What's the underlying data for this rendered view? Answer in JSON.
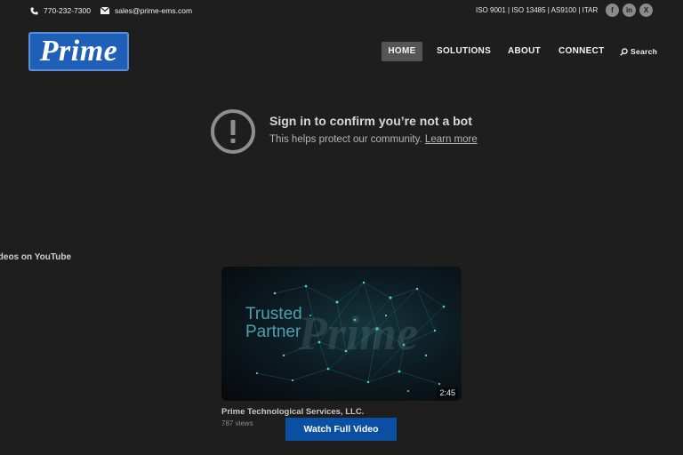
{
  "topbar": {
    "phone": "770-232-7300",
    "email": "sales@prime-ems.com",
    "certifications": "ISO 9001 | ISO 13485 | AS9100 | ITAR",
    "social": {
      "facebook": "f",
      "linkedin": "in",
      "x": "X"
    }
  },
  "logo": {
    "text": "Prime",
    "bg_color": "#1f5fb8"
  },
  "nav": {
    "items": [
      {
        "label": "HOME",
        "active": true
      },
      {
        "label": "SOLUTIONS"
      },
      {
        "label": "ABOUT"
      },
      {
        "label": "CONNECT"
      }
    ],
    "search_label": "Search"
  },
  "notice": {
    "icon": "exclamation-circle-icon",
    "title": "Sign in to confirm you’re not a bot",
    "subtitle": "This helps protect our community.",
    "link": "Learn more"
  },
  "videos": {
    "heading": "ideos on YouTube",
    "card": {
      "thumbnail_text_line1": "Trusted",
      "thumbnail_text_line2": "Partner",
      "thumbnail_watermark": "Prime",
      "duration": "2:45",
      "channel": "Prime Technological Services, LLC.",
      "views": "787 views"
    },
    "watch_button": "Watch Full Video"
  },
  "colors": {
    "background": "#1e1e1e",
    "accent": "#0b4fa3",
    "nav_active": "#555555"
  }
}
